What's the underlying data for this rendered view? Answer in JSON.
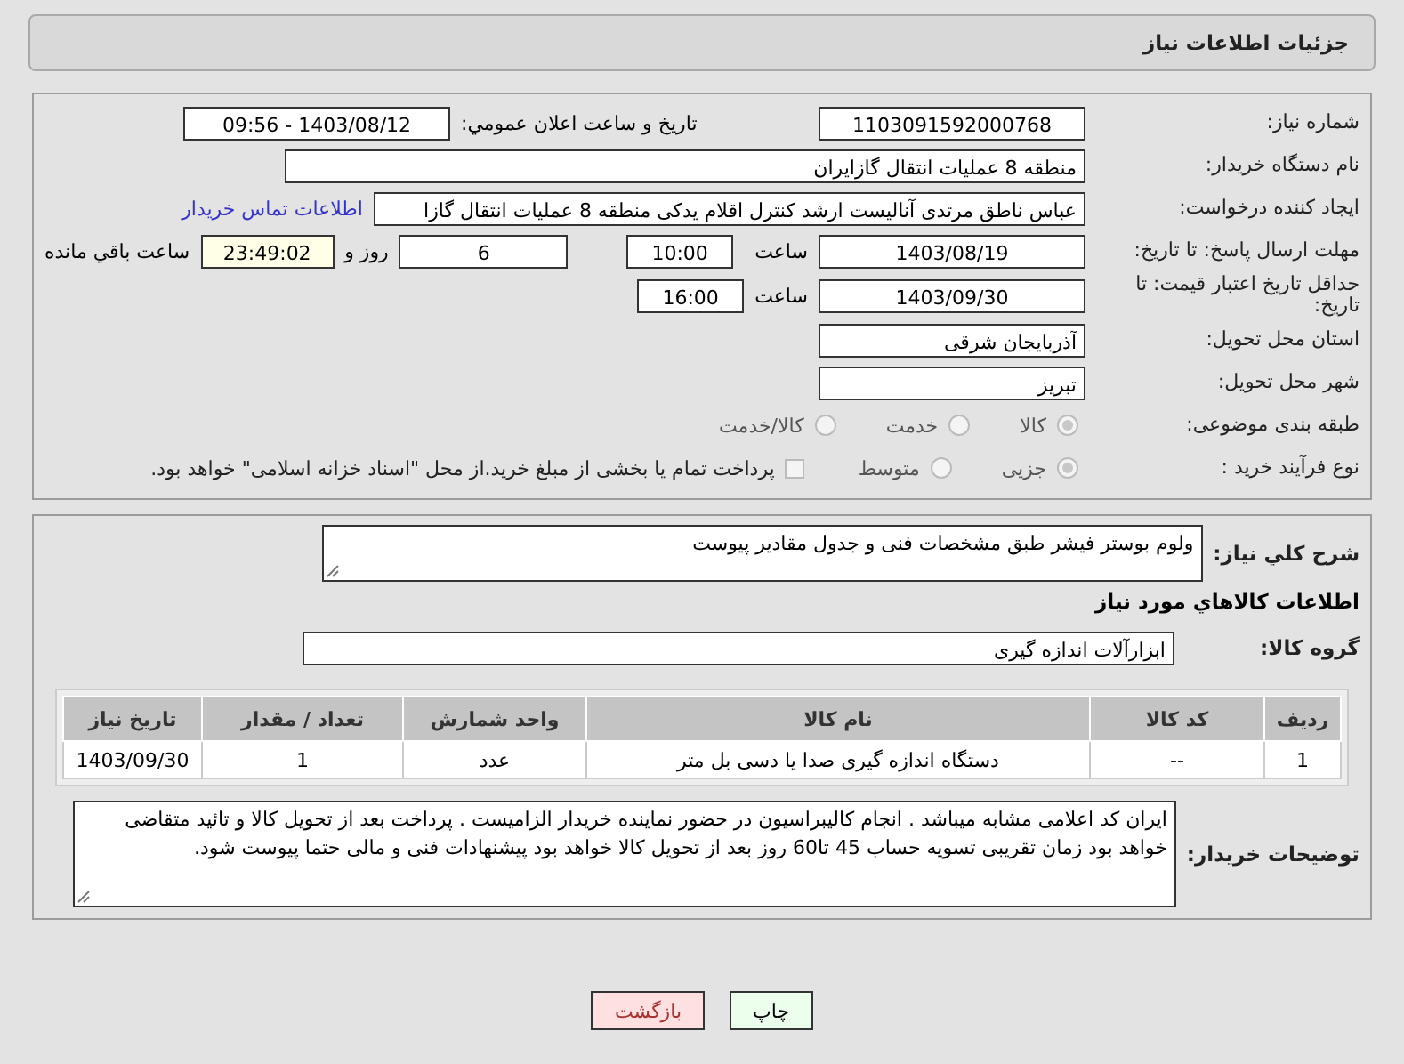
{
  "header": {
    "title": "جزئیات اطلاعات نیاز"
  },
  "need_number": {
    "label": "شماره نیاز:",
    "value": "1103091592000768"
  },
  "announce": {
    "label": "تاریخ و ساعت اعلان عمومي:",
    "value": "1403/08/12 - 09:56"
  },
  "buyer_org": {
    "label": "نام دستگاه خریدار:",
    "value": "منطقه 8 عملیات انتقال گازایران"
  },
  "requester": {
    "label": "ایجاد کننده درخواست:",
    "value": "عباس ناطق مرتدی آنالیست ارشد کنترل اقلام یدکی منطقه 8 عملیات انتقال گازا",
    "link": "اطلاعات تماس خریدار"
  },
  "reply_deadline": {
    "label": "مهلت ارسال پاسخ: تا تاریخ:",
    "date": "1403/08/19",
    "time_label": "ساعت",
    "time": "10:00",
    "days": "6",
    "days_label": "روز و",
    "remaining": "23:49:02",
    "remaining_label": "ساعت باقي مانده"
  },
  "price_validity": {
    "label": "حداقل تاریخ اعتبار قیمت: تا تاریخ:",
    "date": "1403/09/30",
    "time_label": "ساعت",
    "time": "16:00"
  },
  "province": {
    "label": "استان محل تحویل:",
    "value": "آذربایجان شرقی"
  },
  "city": {
    "label": "شهر محل تحویل:",
    "value": "تبریز"
  },
  "category": {
    "label": "طبقه بندی موضوعی:",
    "options": [
      {
        "label": "کالا",
        "selected": true
      },
      {
        "label": "خدمت",
        "selected": false
      },
      {
        "label": "کالا/خدمت",
        "selected": false
      }
    ]
  },
  "purchase_type": {
    "label": "نوع فرآیند خرید :",
    "options": [
      {
        "label": "جزیی",
        "selected": true
      },
      {
        "label": "متوسط",
        "selected": false
      }
    ],
    "payment": {
      "checked": false,
      "text": "پرداخت تمام یا بخشی از مبلغ خرید.از محل \"اسناد خزانه اسلامی\" خواهد بود."
    }
  },
  "description": {
    "label": "شرح کلي نیاز:",
    "value": "ولوم بوستر فیشر  طبق مشخصات فنی و جدول مقادیر پیوست"
  },
  "goods_title": "اطلاعات کالاهاي مورد نیاز",
  "goods_group": {
    "label": "گروه کالا:",
    "value": "ابزارآلات اندازه گیری"
  },
  "table": {
    "columns": [
      "ردیف",
      "کد کالا",
      "نام کالا",
      "واحد شمارش",
      "تعداد / مقدار",
      "تاریخ نیاز"
    ],
    "rows": [
      [
        "1",
        "--",
        "دستگاه اندازه گیری صدا یا دسی بل متر",
        "عدد",
        "1",
        "1403/09/30"
      ]
    ]
  },
  "buyer_notes": {
    "label": "توضیحات خریدار:",
    "value": "ایران کد اعلامی مشابه میباشد . انجام کالیبراسیون در حضور نماینده خریدار الزامیست . پرداخت  بعد از تحویل کالا و تائید متقاضی خواهد بود زمان  تقریبی تسویه حساب 45 تا60 روز بعد از تحویل کالا خواهد بود پیشنهادات فنی و مالی حتما پیوست شود."
  },
  "buttons": [
    {
      "label": "چاپ",
      "kind": "print"
    },
    {
      "label": "بازگشت",
      "kind": "back"
    }
  ]
}
